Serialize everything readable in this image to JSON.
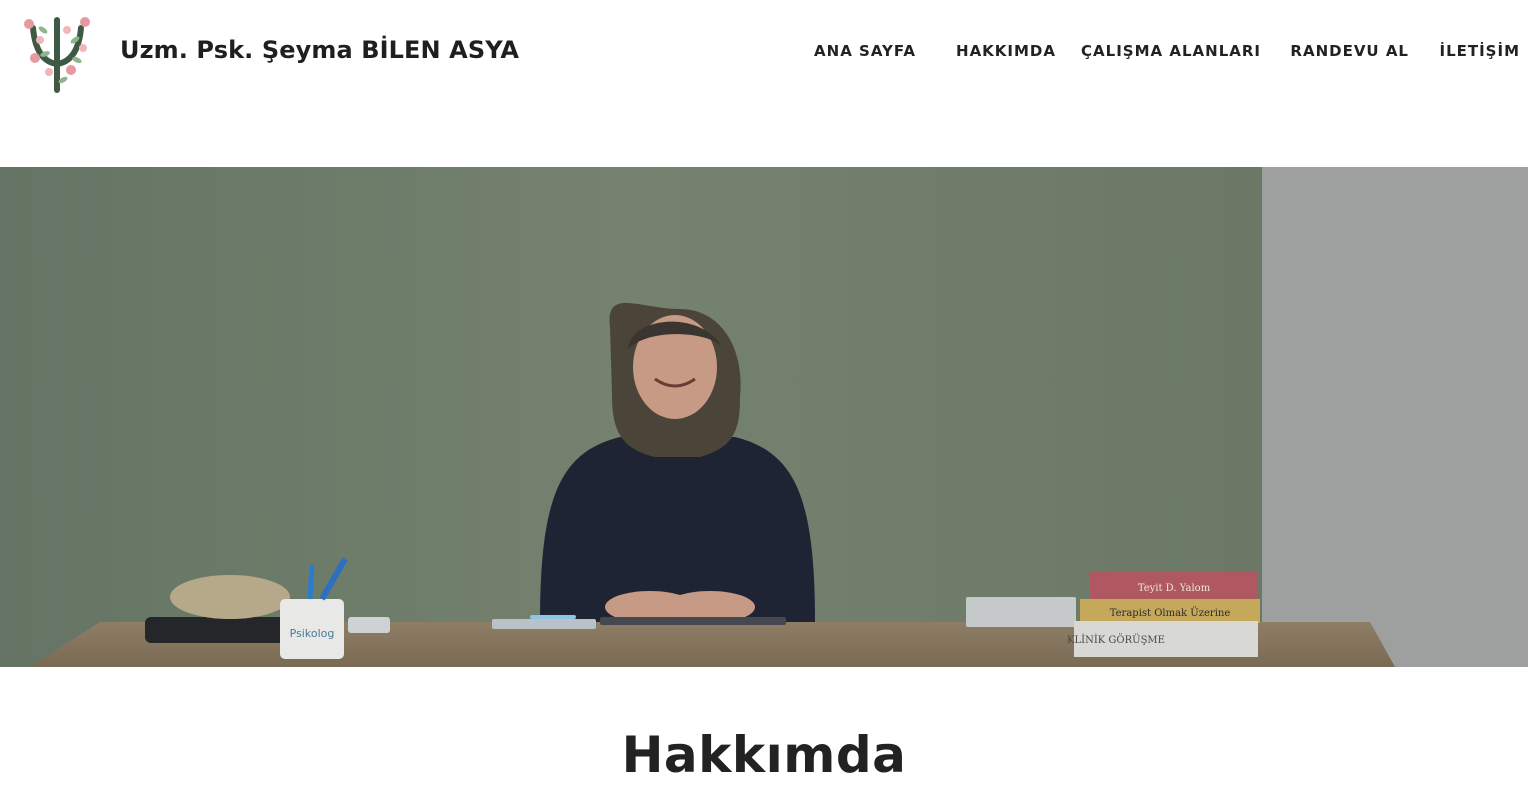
{
  "header": {
    "site_title": "Uzm. Psk. Şeyma BİLEN ASYA",
    "logo_icon": "psi-floral-logo-icon"
  },
  "nav": {
    "items": [
      {
        "label": "ANA SAYFA"
      },
      {
        "label": "HAKKIMDA"
      },
      {
        "label": "ÇALIŞMA ALANLARI"
      },
      {
        "label": "RANDEVU AL"
      },
      {
        "label": "İLETİŞİM"
      }
    ]
  },
  "hero": {
    "books": [
      {
        "title": "Teyit D. Yalom"
      },
      {
        "title": "Terapist Olmak Üzerine"
      },
      {
        "title": "KLİNİK GÖRÜŞME"
      }
    ],
    "mug_text": "Psikolog"
  },
  "main": {
    "section_title": "Hakkımda"
  },
  "colors": {
    "wall": "#6f7c6e",
    "desk": "#8a7a63",
    "text_dark": "#222222",
    "logo_green": "#3f5a44",
    "logo_pink": "#e59aa0"
  }
}
